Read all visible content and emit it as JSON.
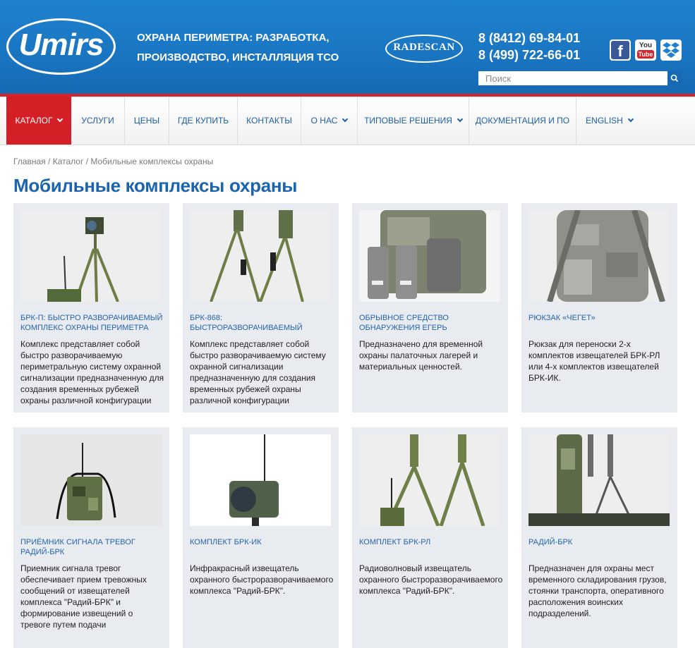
{
  "header": {
    "logo_text": "Umirs",
    "tagline_line1": "Охрана периметра: разработка,",
    "tagline_line2": "производство, инсталляция ТСО",
    "partner_logo_text": "RADESCAN",
    "phone1": "8 (8412) 69-84-01",
    "phone2": "8 (499) 722-66-01",
    "social": {
      "facebook_glyph": "f",
      "youtube_top": "You",
      "youtube_bottom": "Tube"
    },
    "search": {
      "placeholder": "Поиск"
    }
  },
  "nav": {
    "items": [
      {
        "label": "Каталог",
        "has_dropdown": true,
        "active": true
      },
      {
        "label": "Услуги",
        "has_dropdown": false
      },
      {
        "label": "Цены",
        "has_dropdown": false
      },
      {
        "label": "Где купить",
        "has_dropdown": false
      },
      {
        "label": "Контакты",
        "has_dropdown": false
      },
      {
        "label": "О нас",
        "has_dropdown": true
      },
      {
        "label": "Типовые решения",
        "has_dropdown": true
      },
      {
        "label": "Документация и ПО",
        "has_dropdown": false
      },
      {
        "label": "English",
        "has_dropdown": true
      }
    ]
  },
  "breadcrumb": {
    "home": "Главная",
    "catalog": "Каталог",
    "current": "Мобильные комплексы охраны",
    "separator": "/"
  },
  "page_title": "Мобильные комплексы охраны",
  "products": [
    {
      "title": "БРК-П: быстро разворачиваемый комплекс охраны периметра",
      "description": "Комплекс представляет собой быстро разворачиваемую периметральную систему охранной сигнализации предназначенную для создания временных рубежей охраны различной конфигурации"
    },
    {
      "title": "БРК-868: быстроразворачиваемый",
      "description": "Комплекс представляет собой быстро разворачиваемую систему охранной сигнализации предназначенную для создания временных рубежей охраны различной конфигурации"
    },
    {
      "title": "Обрывное средство обнаружения Егерь",
      "description": "Предназначено для временной охраны палаточных лагерей и материальных ценностей."
    },
    {
      "title": "Рюкзак «Чегет»",
      "description": "Рюкзак для переноски 2-х комплектов извещателей БРК-РЛ или 4-х комплектов извещателей БРК-ИК."
    },
    {
      "title": "Приёмник сигнала тревог Радий-БРК",
      "description": "Приемник сигнала тревог обеспечивает прием тревожных сообщений от извещателей комплекса \"Радий-БРК\" и формирование извещений о тревоге путем подачи"
    },
    {
      "title": "Комплект БРК-ИК",
      "description": "Инфракрасный извещатель охранного быстроразворачиваемого комплекса \"Радий-БРК\"."
    },
    {
      "title": "Комплект БРК-РЛ",
      "description": "Радиоволновый извещатель охранного быстроразворачиваемого комплекса \"Радий-БРК\"."
    },
    {
      "title": "Радий-БРК",
      "description": "Предназначен для охраны мест временного складирования грузов, стоянки транспорта, оперативного расположения воинских подразделений."
    }
  ],
  "colors": {
    "header_blue": "#1a76c2",
    "accent_red": "#d51f27",
    "link_blue": "#2564ad",
    "card_bg": "#e8ebef"
  }
}
